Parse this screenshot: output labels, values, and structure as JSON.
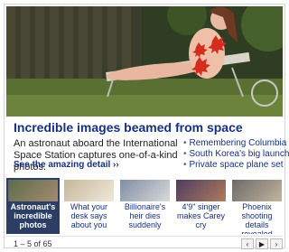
{
  "feature": {
    "headline": "Incredible images beamed from space",
    "summary": "An astronaut aboard the International Space Station captures one-of-a-kind photos.",
    "more_link": "See the amazing detail ››"
  },
  "related_links": [
    "Remembering Columbia",
    "South Korea's big launch",
    "Private space plane set"
  ],
  "thumbnails": [
    {
      "caption": "Astronaut's incredible photos",
      "active": true
    },
    {
      "caption": "What your desk says about you",
      "active": false
    },
    {
      "caption": "Billionaire's heir dies suddenly",
      "active": false
    },
    {
      "caption": "4'9\" singer makes Carey cry",
      "active": false
    },
    {
      "caption": "Phoenix shooting details revealed",
      "active": false
    }
  ],
  "pager": {
    "counter": "1 – 5 of 65",
    "prev_label": "‹",
    "play_label": "▶",
    "next_label": "›"
  },
  "colors": {
    "headline": "#16317d",
    "active_thumb_bg": "#2c3e66"
  }
}
